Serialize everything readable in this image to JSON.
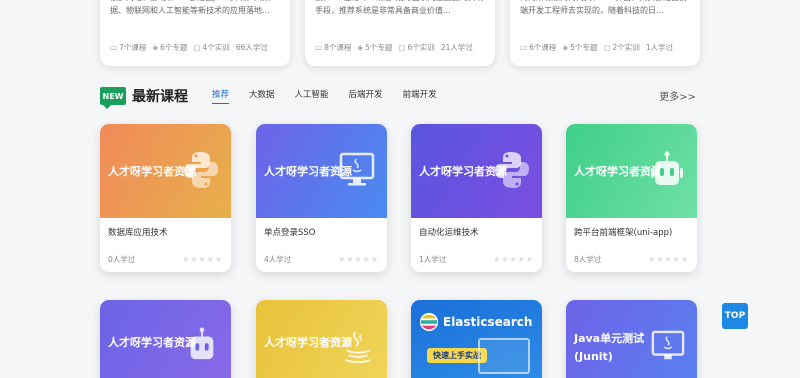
{
  "top_cards": [
    {
      "desc": "Java语言目前市面上最为流行的编程语言之一，很多网站、游戏和APP都是由Java实现。大数据、物联网和人工智能等新技术的应用落地...",
      "courses": "7个课程",
      "topics": "6个专题",
      "labs": "4个实训",
      "learners": "66人学过"
    },
    {
      "desc": "随着人工智能技术不在各领域的渗透与发展，“个性化”，“精准”成为互联网最重要的实现手段，推荐系统是非常具备商业价值...",
      "courses": "8个课程",
      "topics": "5个专题",
      "labs": "6个实训",
      "learners": "21人学过"
    },
    {
      "desc": "当你通过计算机、手机等设备接入互联网时，看到的所有漂亮的网页、APP界面，其实都是由前端开发工程师去实现的，随着科技的日...",
      "courses": "6个课程",
      "topics": "5个专题",
      "labs": "2个实训",
      "learners": "1人学过"
    }
  ],
  "section": {
    "badge": "NEW",
    "title": "最新课程",
    "tabs": [
      "推荐",
      "大数据",
      "人工智能",
      "后端开发",
      "前端开发"
    ],
    "active_tab": "推荐",
    "more": "更多>>"
  },
  "courses": [
    {
      "cover_title": "人才呀学习者资源",
      "name": "数据库应用技术",
      "learners": "0人学过",
      "stars": "★★★★★",
      "icon": "python-icon"
    },
    {
      "cover_title": "人才呀学习者资源",
      "name": "单点登录SSO",
      "learners": "4人学过",
      "stars": "★★★★★",
      "icon": "java-screen-icon"
    },
    {
      "cover_title": "人才呀学习者资源",
      "name": "自动化运维技术",
      "learners": "1人学过",
      "stars": "★★★★★",
      "icon": "python-icon"
    },
    {
      "cover_title": "人才呀学习者资源",
      "name": "跨平台前端框架(uni-app)",
      "learners": "8人学过",
      "stars": "★★★★★",
      "icon": "robot-icon"
    }
  ],
  "courses_row2": [
    {
      "cover_title": "人才呀学习者资源",
      "icon": "robot-icon"
    },
    {
      "cover_title": "人才呀学习者资源",
      "icon": "java-cup-icon"
    },
    {
      "cover_title": "Elasticsearch",
      "subtitle": "快速上手实战",
      "icon": "elasticsearch-icon"
    },
    {
      "cover_title": "Java单元测试",
      "subtitle": "(Junit)",
      "icon": "java-screen-icon"
    }
  ],
  "top_button": "TOP"
}
